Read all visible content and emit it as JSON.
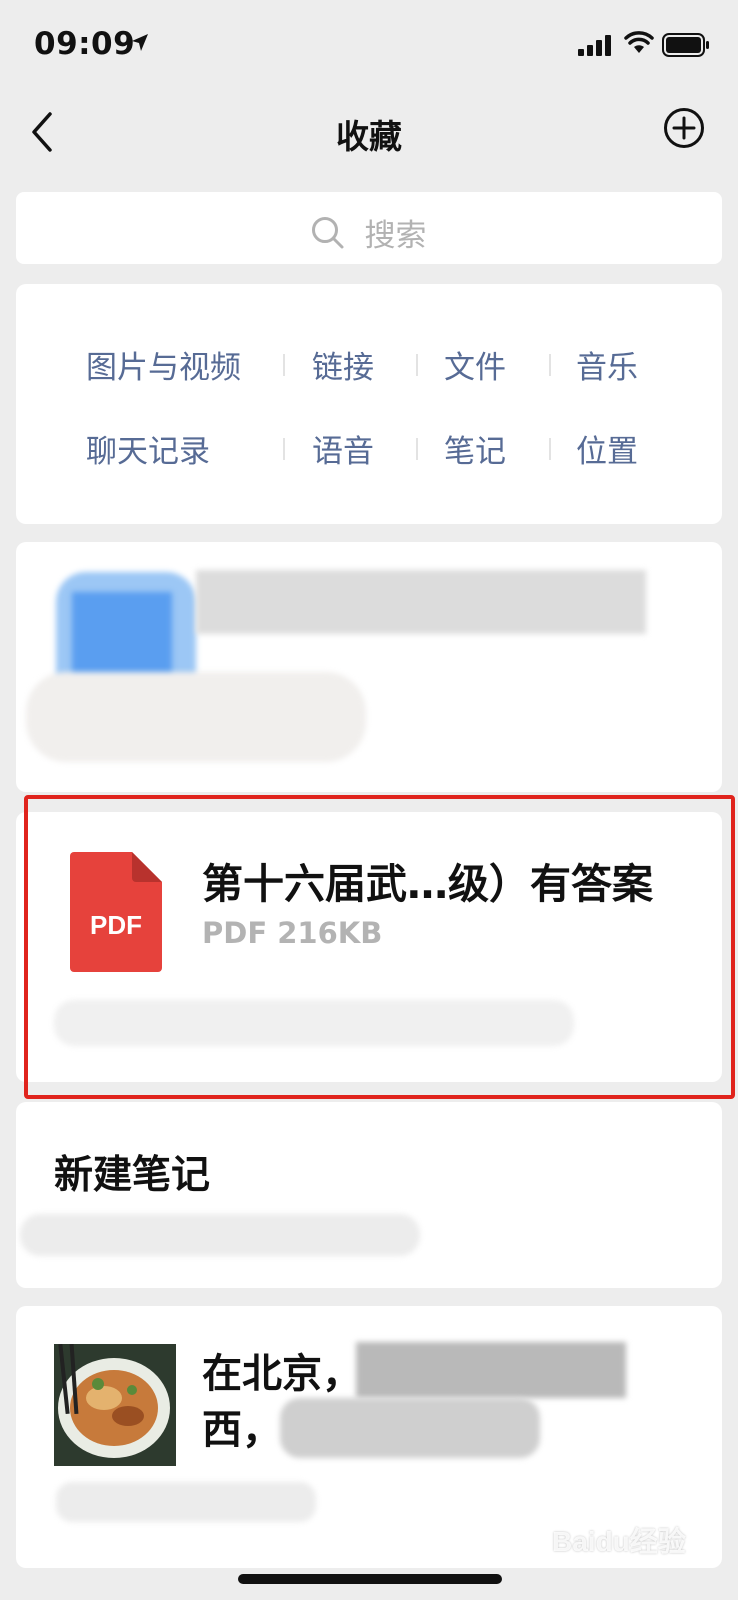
{
  "status_bar": {
    "time": "09:09"
  },
  "nav": {
    "title": "收藏"
  },
  "search": {
    "placeholder": "搜索"
  },
  "categories": {
    "row1": [
      "图片与视频",
      "链接",
      "文件",
      "音乐"
    ],
    "row2": [
      "聊天记录",
      "语音",
      "笔记",
      "位置"
    ]
  },
  "items": {
    "file": {
      "title": "第十六届武…级）有答案",
      "file_type_icon_label": "PDF",
      "meta": "PDF 216KB"
    },
    "note": {
      "title": "新建笔记"
    },
    "post": {
      "title_line1": "在北京，",
      "title_line2": "西，"
    }
  },
  "watermark": {
    "text": "Baidu经验"
  },
  "colors": {
    "page_background": "#ededed",
    "card_background": "#ffffff",
    "category_text": "#576b95",
    "pdf_red": "#e6423c",
    "highlight_red": "#e0241d",
    "secondary_text": "#b3b3b3"
  },
  "icons": {
    "back": "chevron-left-icon",
    "add": "plus-circle-icon",
    "search": "search-icon",
    "file_type": "pdf-file-icon"
  }
}
